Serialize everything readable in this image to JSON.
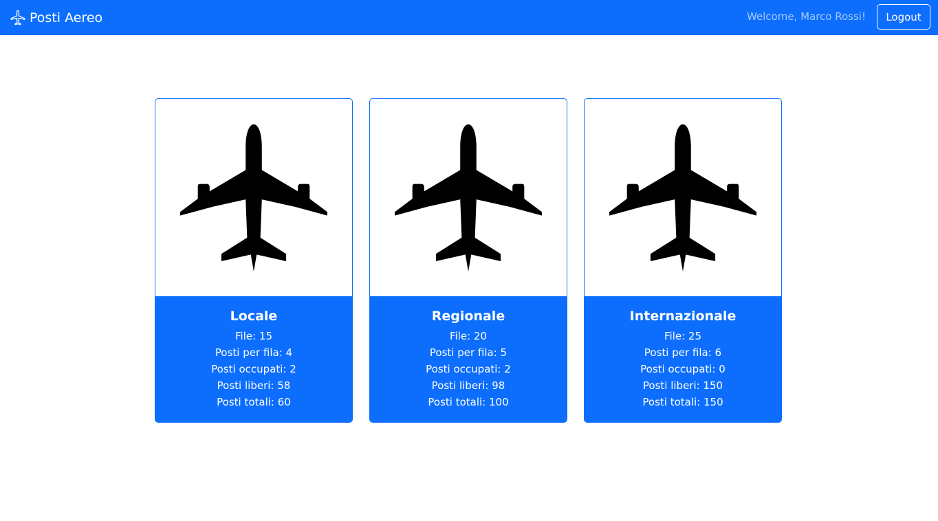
{
  "navbar": {
    "brand": "Posti Aereo",
    "brand_icon": "airplane-icon",
    "welcome": "Welcome, Marco Rossi!",
    "logout_label": "Logout"
  },
  "colors": {
    "primary": "#0d6efd",
    "text_light": "#ffffff",
    "welcome_text": "rgba(255,255,255,0.62)",
    "icon": "#000000"
  },
  "cards": [
    {
      "icon": "airplane-icon",
      "title": "Locale",
      "file": "File: 15",
      "posti_per_fila": "Posti per fila: 4",
      "posti_occupati": "Posti occupati: 2",
      "posti_liberi": "Posti liberi: 58",
      "posti_totali": "Posti totali: 60"
    },
    {
      "icon": "airplane-icon",
      "title": "Regionale",
      "file": "File: 20",
      "posti_per_fila": "Posti per fila: 5",
      "posti_occupati": "Posti occupati: 2",
      "posti_liberi": "Posti liberi: 98",
      "posti_totali": "Posti totali: 100"
    },
    {
      "icon": "airplane-icon",
      "title": "Internazionale",
      "file": "File: 25",
      "posti_per_fila": "Posti per fila: 6",
      "posti_occupati": "Posti occupati: 0",
      "posti_liberi": "Posti liberi: 150",
      "posti_totali": "Posti totali: 150"
    }
  ]
}
